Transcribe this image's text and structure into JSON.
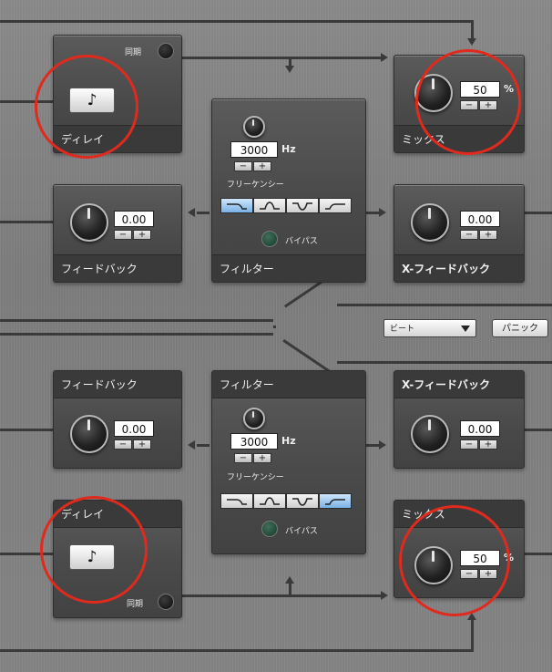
{
  "top": {
    "delay": {
      "title": "ディレイ",
      "note_glyph": "♪",
      "sync_label": "同期",
      "note_name": "note-icon"
    },
    "mix": {
      "title": "ミックス",
      "value": "50",
      "unit": "%",
      "minus": "−",
      "plus": "+"
    },
    "feedback": {
      "title": "フィードバック",
      "value": "0.00",
      "minus": "−",
      "plus": "+"
    },
    "filter": {
      "title": "フィルター",
      "freq": "3000",
      "unit": "Hz",
      "freq_label": "フリーケンシー",
      "bypass_label": "バイパス",
      "minus": "−",
      "plus": "+",
      "active_shape": 0
    },
    "xfeedback": {
      "title": "X-フィードバック",
      "value": "0.00",
      "minus": "−",
      "plus": "+"
    }
  },
  "bottom": {
    "feedback": {
      "title": "フィードバック",
      "value": "0.00",
      "minus": "−",
      "plus": "+"
    },
    "filter": {
      "title": "フィルター",
      "freq": "3000",
      "unit": "Hz",
      "freq_label": "フリーケンシー",
      "bypass_label": "バイパス",
      "minus": "−",
      "plus": "+",
      "active_shape": 3
    },
    "xfeedback": {
      "title": "X-フィードバック",
      "value": "0.00",
      "minus": "−",
      "plus": "+"
    },
    "delay": {
      "title": "ディレイ",
      "note_glyph": "♪",
      "sync_label": "同期"
    },
    "mix": {
      "title": "ミックス",
      "value": "50",
      "unit": "%",
      "minus": "−",
      "plus": "+"
    }
  },
  "controls": {
    "mode_select": "ビート",
    "panic_label": "パニック"
  },
  "colors": {
    "highlight_circle": "#e02a1d",
    "active_shape": "#79b1e6",
    "bypass_led": "#163828"
  }
}
